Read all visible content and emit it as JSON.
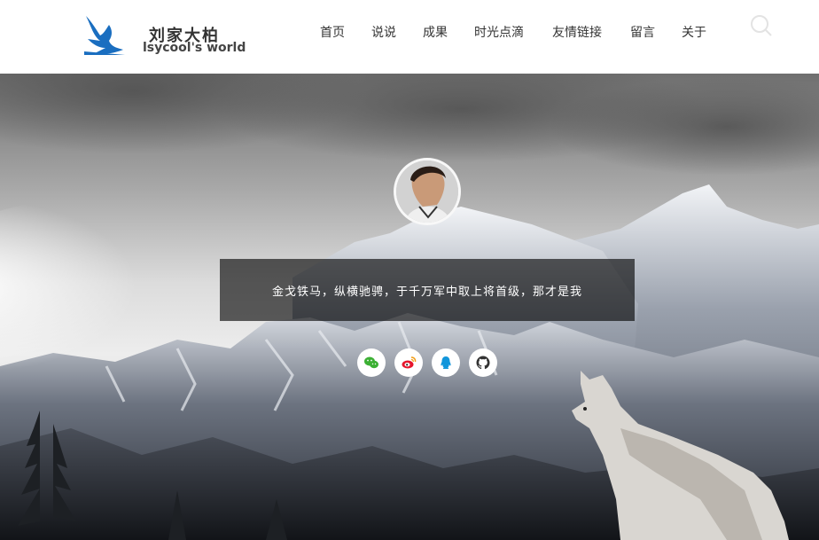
{
  "brand": {
    "name_cn": "刘家大柏",
    "name_en": "lsycool's world",
    "logo_icon": "bird-logo-icon",
    "accent_color": "#1a6ec0"
  },
  "nav": {
    "items": [
      {
        "label": "首页"
      },
      {
        "label": "说说"
      },
      {
        "label": "成果"
      },
      {
        "label": "时光点滴"
      },
      {
        "label": "友情链接"
      },
      {
        "label": "留言"
      },
      {
        "label": "关于"
      }
    ],
    "search_icon": "search-icon"
  },
  "hero": {
    "motto": "金戈铁马，纵横驰骋，于千万军中取上将首级，那才是我",
    "avatar_icon": "avatar",
    "social": [
      {
        "icon": "wechat-icon",
        "color": "#3cb034"
      },
      {
        "icon": "weibo-icon",
        "color": "#e6162d"
      },
      {
        "icon": "qq-icon",
        "color": "#1296db"
      },
      {
        "icon": "github-icon",
        "color": "#333333"
      }
    ]
  }
}
